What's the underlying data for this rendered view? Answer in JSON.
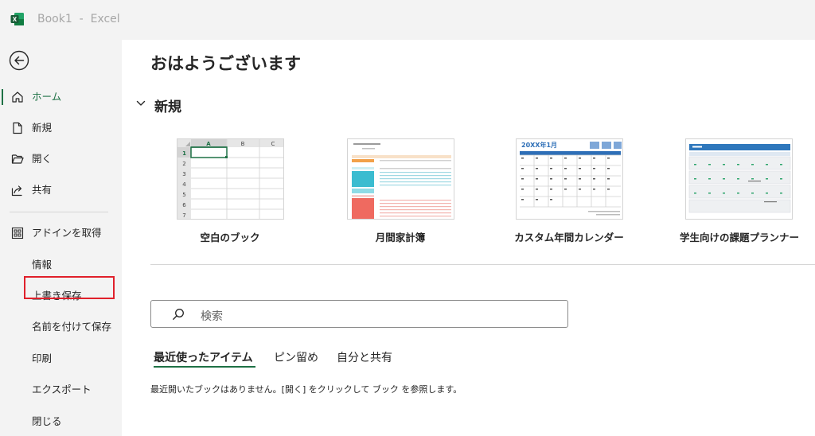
{
  "window": {
    "title": "Book1  -  Excel",
    "accent": "#1e7145"
  },
  "sidebar": {
    "back_icon": "back-arrow-icon",
    "items": [
      {
        "label": "ホーム",
        "icon": "home-icon",
        "active": true
      },
      {
        "label": "新規",
        "icon": "new-document-icon"
      },
      {
        "label": "開く",
        "icon": "folder-open-icon"
      },
      {
        "label": "共有",
        "icon": "share-icon"
      },
      {
        "label": "アドインを取得",
        "icon": "add-ins-icon"
      },
      {
        "label": "情報"
      },
      {
        "label": "上書き保存"
      },
      {
        "label": "名前を付けて保存",
        "highlighted": true
      },
      {
        "label": "印刷"
      },
      {
        "label": "エクスポート"
      },
      {
        "label": "閉じる"
      }
    ]
  },
  "main": {
    "greeting": "おはようございます",
    "new_section": {
      "title": "新規",
      "templates": [
        {
          "caption": "空白のブック",
          "thumb_cols": [
            "A",
            "B",
            "C"
          ],
          "thumb_rows": [
            "1",
            "2",
            "3",
            "4",
            "5",
            "6",
            "7"
          ]
        },
        {
          "caption": "月間家計簿"
        },
        {
          "caption": "カスタム年間カレンダー",
          "thumb_title": "20XX年1月"
        },
        {
          "caption": "学生向けの課題プランナー"
        }
      ]
    },
    "search": {
      "placeholder": "検索",
      "icon": "search-icon"
    },
    "tabs": [
      {
        "label": "最近使ったアイテム",
        "active": true
      },
      {
        "label": "ピン留め"
      },
      {
        "label": "自分と共有"
      }
    ],
    "empty_message": "最近開いたブックはありません。[開く] をクリックして ブック を参照します。"
  }
}
